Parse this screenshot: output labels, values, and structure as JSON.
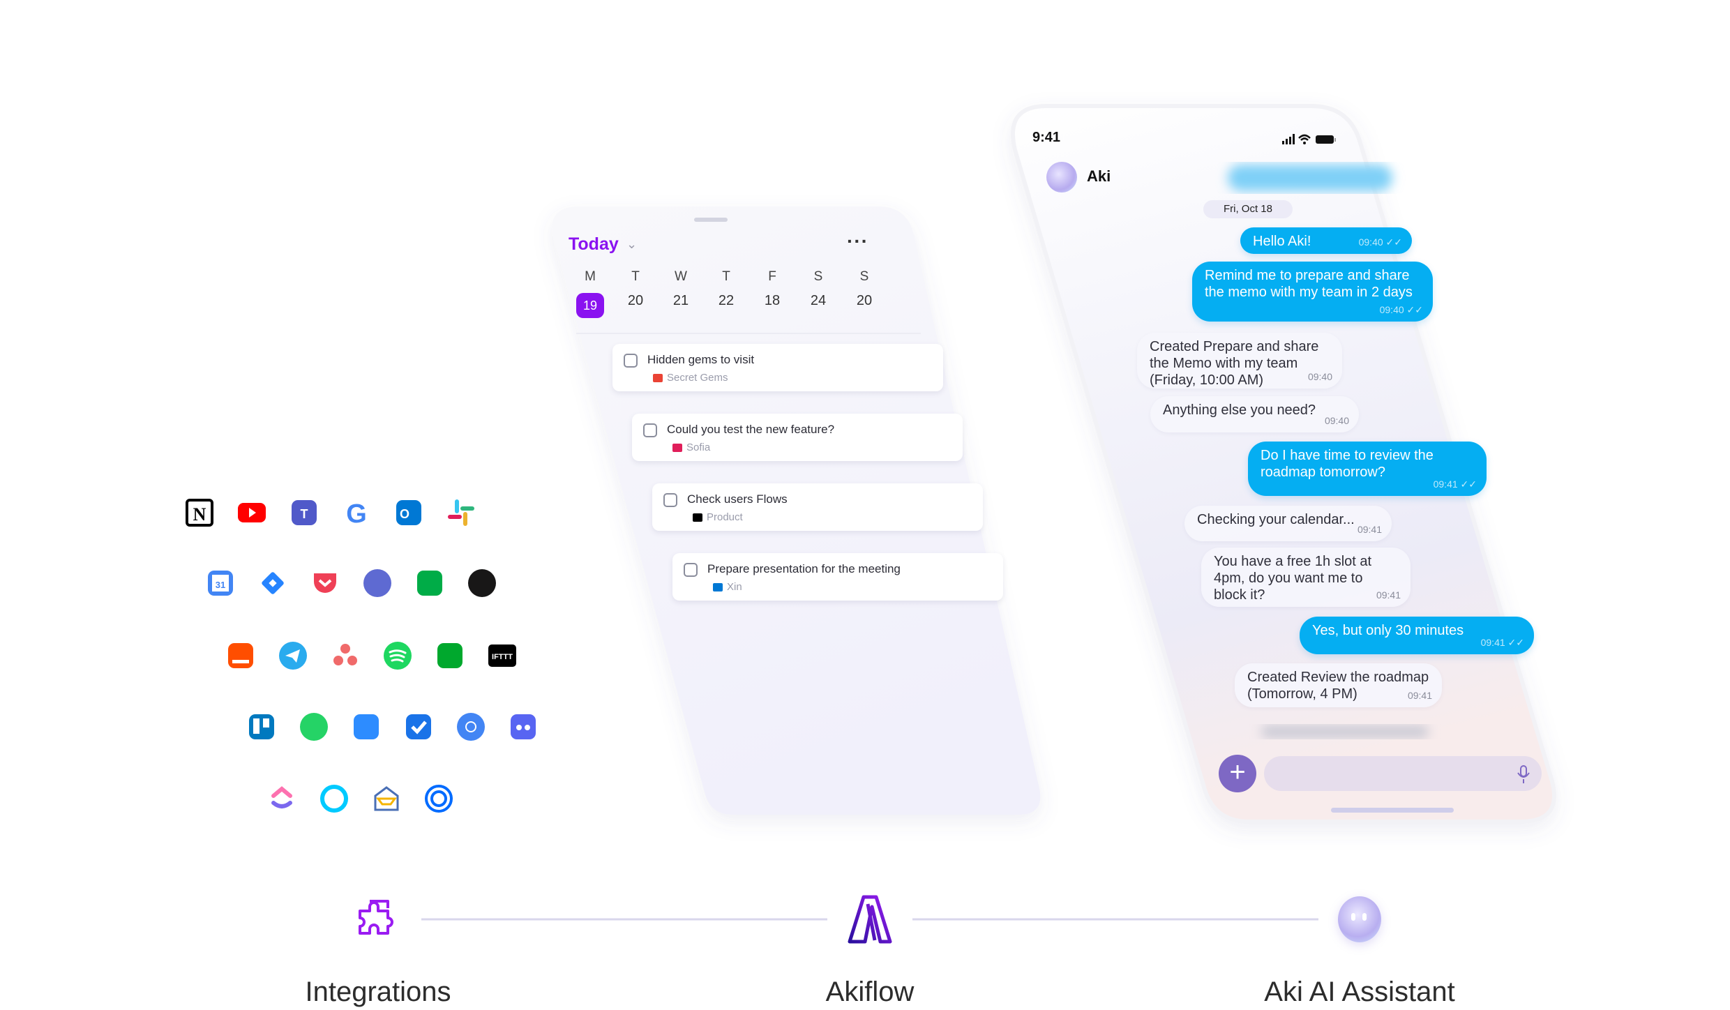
{
  "integrations": {
    "rows": [
      [
        {
          "name": "notion",
          "color": "#000000"
        },
        {
          "name": "youtube",
          "color": "#FF0000"
        },
        {
          "name": "microsoft-teams",
          "color": "#5059C9"
        },
        {
          "name": "google",
          "color": "#4285F4"
        },
        {
          "name": "outlook",
          "color": "#0078D4"
        },
        {
          "name": "slack",
          "color": "#E01E5A"
        }
      ],
      [
        {
          "name": "google-calendar",
          "color": "#4285F4"
        },
        {
          "name": "jira",
          "color": "#2684FF"
        },
        {
          "name": "pocket",
          "color": "#EF4056"
        },
        {
          "name": "linear",
          "color": "#5E6AD2"
        },
        {
          "name": "google-meet",
          "color": "#00AC47"
        },
        {
          "name": "github",
          "color": "#181717"
        }
      ],
      [
        {
          "name": "orange-inbox",
          "color": "#FF4E00"
        },
        {
          "name": "telegram",
          "color": "#2AABEE"
        },
        {
          "name": "asana",
          "color": "#F06A6A"
        },
        {
          "name": "spotify",
          "color": "#1ED760"
        },
        {
          "name": "evernote",
          "color": "#00A82D"
        },
        {
          "name": "ifttt",
          "color": "#000000",
          "text": "IFTTT"
        }
      ],
      [
        {
          "name": "trello",
          "color": "#0079BF"
        },
        {
          "name": "whatsapp",
          "color": "#25D366"
        },
        {
          "name": "zoom",
          "color": "#2D8CFF"
        },
        {
          "name": "task-check",
          "color": "#1A73E8"
        },
        {
          "name": "chrome",
          "color": "#4285F4"
        },
        {
          "name": "discord",
          "color": "#5865F2"
        }
      ],
      [
        {
          "name": "clickup",
          "color": "#7B68EE"
        },
        {
          "name": "alexa",
          "color": "#00CAFF"
        },
        {
          "name": "email-client",
          "color": "#4A6FB5"
        },
        {
          "name": "calendly",
          "color": "#006BFF"
        }
      ]
    ]
  },
  "tasks_phone": {
    "title": "Today",
    "accent": "#8A12F0",
    "week_days": [
      "M",
      "T",
      "W",
      "T",
      "F",
      "S",
      "S"
    ],
    "dates": [
      "19",
      "20",
      "21",
      "22",
      "18",
      "24",
      "20"
    ],
    "selected_index": 0,
    "tasks": [
      {
        "title": "Hidden gems to visit",
        "source": "Secret Gems",
        "source_icon": "gmail-icon",
        "icon_color": "#EA4335"
      },
      {
        "title": "Could you test the new feature?",
        "source": "Sofia",
        "source_icon": "slack-icon",
        "icon_color": "#E01E5A"
      },
      {
        "title": "Check users Flows",
        "source": "Product",
        "source_icon": "notion-icon",
        "icon_color": "#000000"
      },
      {
        "title": "Prepare presentation for the meeting",
        "source": "Xin",
        "source_icon": "outlook-icon",
        "icon_color": "#0078D4"
      }
    ]
  },
  "chat_phone": {
    "status_time": "9:41",
    "contact_name": "Aki",
    "date_pill": "Fri, Oct 18",
    "user_bubble_color": "#05AEF2",
    "messages": [
      {
        "from": "user",
        "text": "Hello Aki!",
        "time": "09:40 ✓✓"
      },
      {
        "from": "user",
        "text": "Remind me to prepare and share the memo with my team in 2 days",
        "time": "09:40 ✓✓"
      },
      {
        "from": "ai",
        "text": "Created Prepare and share the Memo with my team (Friday, 10:00 AM)",
        "time": "09:40"
      },
      {
        "from": "ai",
        "text": "Anything else you need?",
        "time": "09:40"
      },
      {
        "from": "user",
        "text": "Do I have time to review the roadmap tomorrow?",
        "time": "09:41 ✓✓"
      },
      {
        "from": "ai",
        "text": "Checking your calendar...",
        "time": "09:41"
      },
      {
        "from": "ai",
        "text": "You have a free 1h slot at 4pm, do you want me to block it?",
        "time": "09:41"
      },
      {
        "from": "user",
        "text": "Yes, but only 30 minutes",
        "time": "09:41 ✓✓"
      },
      {
        "from": "ai",
        "text": "Created Review the roadmap (Tomorrow, 4 PM)",
        "time": "09:41"
      }
    ],
    "input_placeholder": ""
  },
  "bottom": {
    "steps": [
      {
        "label": "Integrations",
        "icon": "puzzle-icon"
      },
      {
        "label": "Akiflow",
        "icon": "akiflow-logo-icon"
      },
      {
        "label": "Aki AI Assistant",
        "icon": "aki-orb-icon"
      }
    ]
  }
}
